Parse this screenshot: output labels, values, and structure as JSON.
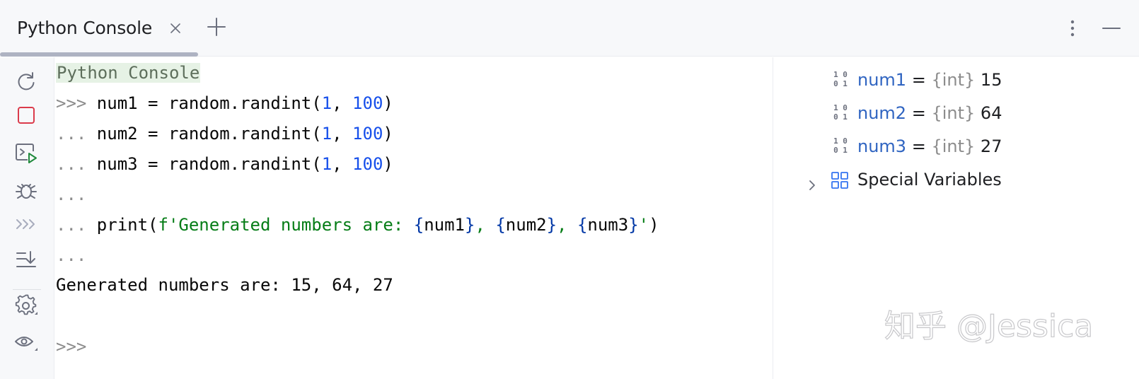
{
  "tab": {
    "title": "Python Console"
  },
  "console": {
    "banner": "Python Console",
    "lines": [
      {
        "prompt": ">>> ",
        "code": "num1 = random.randint(",
        "a": "1",
        "sep": ", ",
        "b": "100",
        "end": ")"
      },
      {
        "prompt": "... ",
        "code": "num2 = random.randint(",
        "a": "1",
        "sep": ", ",
        "b": "100",
        "end": ")"
      },
      {
        "prompt": "... ",
        "code": "num3 = random.randint(",
        "a": "1",
        "sep": ", ",
        "b": "100",
        "end": ")"
      }
    ],
    "empty_prompt": "...",
    "print_line": {
      "prompt": "... ",
      "call": "print(",
      "str_start": "f'Generated numbers are: ",
      "v1": "num1",
      "v2": "num2",
      "v3": "num3",
      "comma": ", ",
      "str_end": "'",
      "close": ")"
    },
    "empty_prompt2": "...",
    "output": "Generated numbers are: 15, 64, 27",
    "final_prompt": ">>>"
  },
  "variables": [
    {
      "name": "num1",
      "type": "{int}",
      "value": "15"
    },
    {
      "name": "num2",
      "type": "{int}",
      "value": "64"
    },
    {
      "name": "num3",
      "type": "{int}",
      "value": "27"
    }
  ],
  "special_variables": {
    "label": "Special Variables"
  },
  "icons": {
    "tab_close": "close-icon",
    "tab_add": "plus-icon",
    "more": "more-vertical-icon",
    "minimize": "minimize-icon",
    "toolbar": [
      "rerun-icon",
      "stop-icon",
      "execute-icon",
      "debug-icon",
      "history-icon",
      "scroll-to-end-icon",
      "settings-icon",
      "show-variables-icon"
    ]
  },
  "watermark": "知乎 @Jessica",
  "colors": {
    "number": "#1750eb",
    "string": "#067d17",
    "variable_name": "#2f64c1",
    "prompt": "#8c8c8c",
    "banner_bg": "#e6f2e5"
  }
}
